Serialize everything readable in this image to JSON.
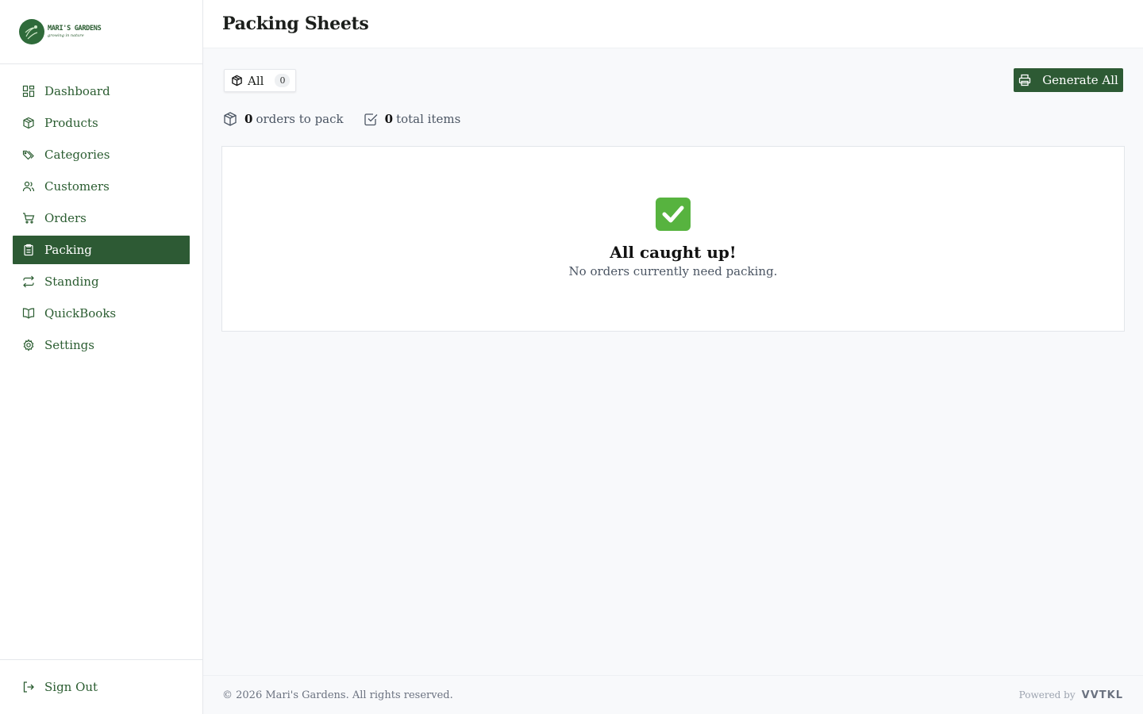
{
  "brand": {
    "name": "MARI'S GARDENS",
    "tagline": "growing in nature",
    "accent": "#2d5a34"
  },
  "sidebar": {
    "items": [
      {
        "label": "Dashboard",
        "icon": "dashboard-icon"
      },
      {
        "label": "Products",
        "icon": "box-icon"
      },
      {
        "label": "Categories",
        "icon": "tags-icon"
      },
      {
        "label": "Customers",
        "icon": "users-icon"
      },
      {
        "label": "Orders",
        "icon": "cart-icon"
      },
      {
        "label": "Packing",
        "icon": "clipboard-icon",
        "active": true
      },
      {
        "label": "Standing",
        "icon": "repeat-icon"
      },
      {
        "label": "QuickBooks",
        "icon": "book-icon"
      },
      {
        "label": "Settings",
        "icon": "gear-icon"
      }
    ],
    "sign_out": "Sign Out"
  },
  "header": {
    "title": "Packing Sheets"
  },
  "main": {
    "filter": {
      "label": "All",
      "count": "0"
    },
    "generate_button": "Generate All",
    "stats": {
      "orders_count": "0",
      "orders_label": "orders to pack",
      "items_count": "0",
      "items_label": "total items"
    },
    "empty_state": {
      "title": "All caught up!",
      "subtitle": "No orders currently need packing."
    }
  },
  "footer": {
    "copyright": "© 2026 Mari's Gardens. All rights reserved.",
    "powered_by": "Powered by",
    "powered_brand": "VVTKL"
  }
}
